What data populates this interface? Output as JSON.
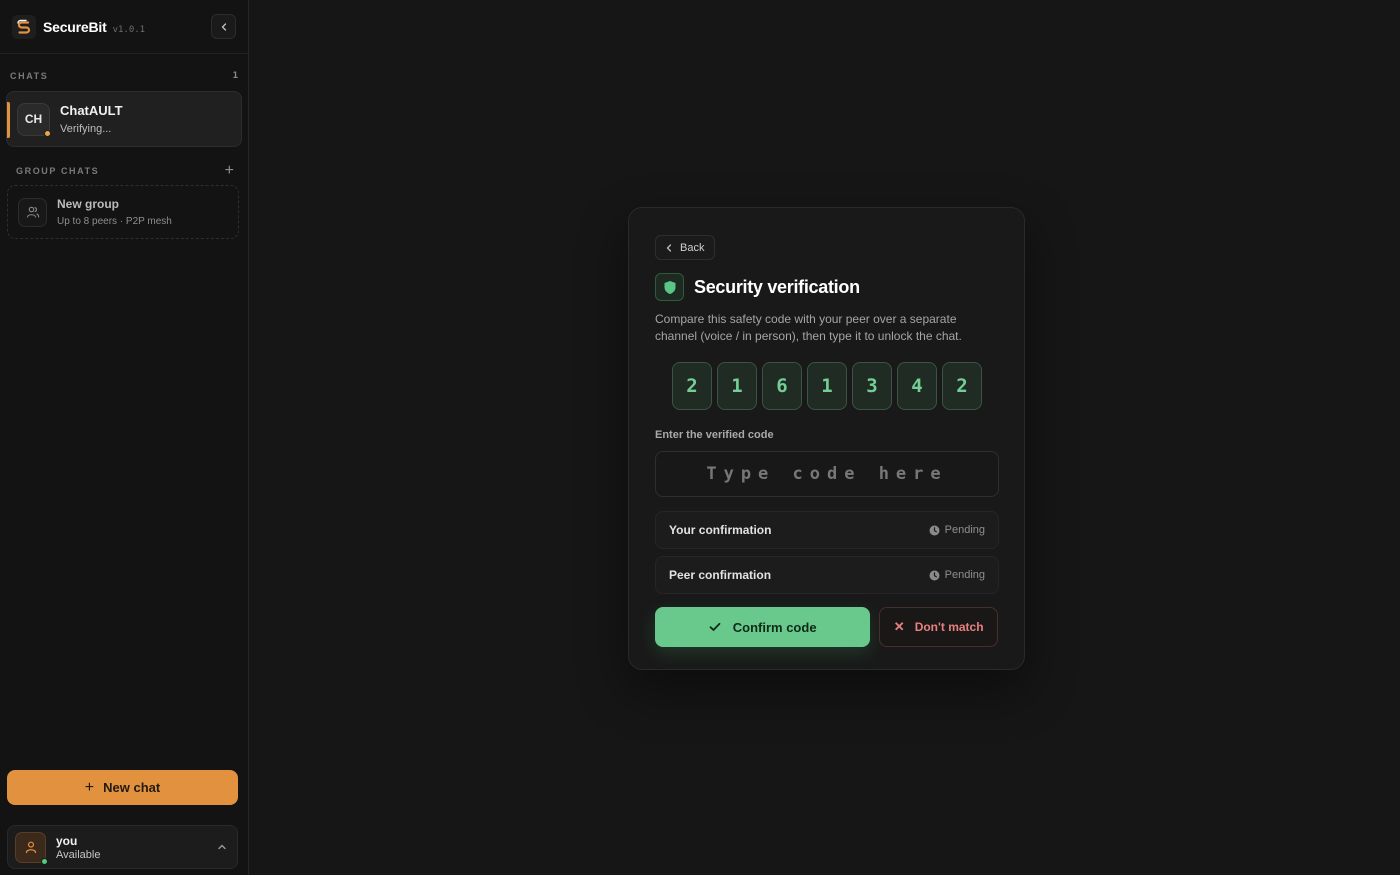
{
  "sidebar": {
    "brand": {
      "name": "SecureBit",
      "version": "v1.0.1"
    },
    "chats_section": {
      "label": "CHATS",
      "count": "1"
    },
    "chats": [
      {
        "initials": "CH",
        "name": "ChatAULT",
        "status": "Verifying..."
      }
    ],
    "groups_section": {
      "label": "GROUP CHATS",
      "add": "+"
    },
    "new_group": {
      "name": "New group",
      "subtitle": "Up to 8 peers · P2P mesh"
    },
    "new_chat_button": "New chat",
    "user": {
      "name": "you",
      "status": "Available"
    }
  },
  "verification": {
    "back_label": "Back",
    "title": "Security verification",
    "description": "Compare this safety code with your peer over a separate channel (voice / in person), then type it to unlock the chat.",
    "code_digits": [
      "2",
      "1",
      "6",
      "1",
      "3",
      "4",
      "2"
    ],
    "input_label": "Enter the verified code",
    "input_placeholder": "Type code here",
    "input_value": "",
    "confirmations": [
      {
        "label": "Your confirmation",
        "status": "Pending"
      },
      {
        "label": "Peer confirmation",
        "status": "Pending"
      }
    ],
    "confirm_button": "Confirm code",
    "mismatch_button": "Don't match"
  },
  "colors": {
    "accent": "#e2923f",
    "success": "#69c98c",
    "danger": "#e88080",
    "background": "#161616"
  }
}
